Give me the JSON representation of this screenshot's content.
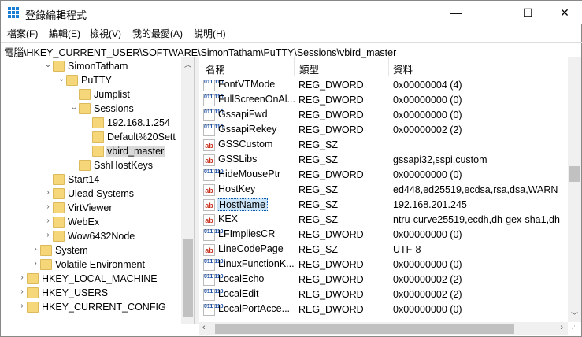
{
  "window": {
    "title": "登錄編輯程式",
    "minimize": "—",
    "maximize": "☐",
    "close": "✕"
  },
  "menu": [
    "檔案(F)",
    "編輯(E)",
    "檢視(V)",
    "我的最愛(A)",
    "說明(H)"
  ],
  "address": "電腦\\HKEY_CURRENT_USER\\SOFTWARE\\SimonTatham\\PuTTY\\Sessions\\vbird_master",
  "tree": [
    {
      "label": "SimonTatham",
      "level": 3,
      "state": "expanded"
    },
    {
      "label": "PuTTY",
      "level": 4,
      "state": "expanded"
    },
    {
      "label": "Jumplist",
      "level": 5,
      "state": "leaf"
    },
    {
      "label": "Sessions",
      "level": 5,
      "state": "expanded"
    },
    {
      "label": "192.168.1.254",
      "level": 6,
      "state": "leaf"
    },
    {
      "label": "Default%20Sett",
      "level": 6,
      "state": "leaf"
    },
    {
      "label": "vbird_master",
      "level": 6,
      "state": "leaf",
      "selected": true
    },
    {
      "label": "SshHostKeys",
      "level": 5,
      "state": "leaf"
    },
    {
      "label": "Start14",
      "level": 3,
      "state": "leaf"
    },
    {
      "label": "Ulead Systems",
      "level": 3,
      "state": "collapsed"
    },
    {
      "label": "VirtViewer",
      "level": 3,
      "state": "collapsed"
    },
    {
      "label": "WebEx",
      "level": 3,
      "state": "collapsed"
    },
    {
      "label": "Wow6432Node",
      "level": 3,
      "state": "collapsed"
    },
    {
      "label": "System",
      "level": 2,
      "state": "collapsed"
    },
    {
      "label": "Volatile Environment",
      "level": 2,
      "state": "collapsed"
    },
    {
      "label": "HKEY_LOCAL_MACHINE",
      "level": 1,
      "state": "collapsed"
    },
    {
      "label": "HKEY_USERS",
      "level": 1,
      "state": "collapsed"
    },
    {
      "label": "HKEY_CURRENT_CONFIG",
      "level": 1,
      "state": "collapsed"
    }
  ],
  "columns": {
    "name": "名稱",
    "type": "類型",
    "data": "資料"
  },
  "values": [
    {
      "name": "FontVTMode",
      "type": "REG_DWORD",
      "data": "0x00000004 (4)"
    },
    {
      "name": "FullScreenOnAl...",
      "type": "REG_DWORD",
      "data": "0x00000000 (0)"
    },
    {
      "name": "GssapiFwd",
      "type": "REG_DWORD",
      "data": "0x00000000 (0)"
    },
    {
      "name": "GssapiRekey",
      "type": "REG_DWORD",
      "data": "0x00000002 (2)"
    },
    {
      "name": "GSSCustom",
      "type": "REG_SZ",
      "data": ""
    },
    {
      "name": "GSSLibs",
      "type": "REG_SZ",
      "data": "gssapi32,sspi,custom"
    },
    {
      "name": "HideMousePtr",
      "type": "REG_DWORD",
      "data": "0x00000000 (0)"
    },
    {
      "name": "HostKey",
      "type": "REG_SZ",
      "data": "ed448,ed25519,ecdsa,rsa,dsa,WARN"
    },
    {
      "name": "HostName",
      "type": "REG_SZ",
      "data": "192.168.201.245",
      "selected": true
    },
    {
      "name": "KEX",
      "type": "REG_SZ",
      "data": "ntru-curve25519,ecdh,dh-gex-sha1,dh-"
    },
    {
      "name": "LFImpliesCR",
      "type": "REG_DWORD",
      "data": "0x00000000 (0)"
    },
    {
      "name": "LineCodePage",
      "type": "REG_SZ",
      "data": "UTF-8"
    },
    {
      "name": "LinuxFunctionK...",
      "type": "REG_DWORD",
      "data": "0x00000000 (0)"
    },
    {
      "name": "LocalEcho",
      "type": "REG_DWORD",
      "data": "0x00000002 (2)"
    },
    {
      "name": "LocalEdit",
      "type": "REG_DWORD",
      "data": "0x00000002 (2)"
    },
    {
      "name": "LocalPortAcce...",
      "type": "REG_DWORD",
      "data": "0x00000000 (0)"
    }
  ],
  "icons": {
    "REG_SZ": "ab",
    "REG_DWORD": "011\n110"
  }
}
